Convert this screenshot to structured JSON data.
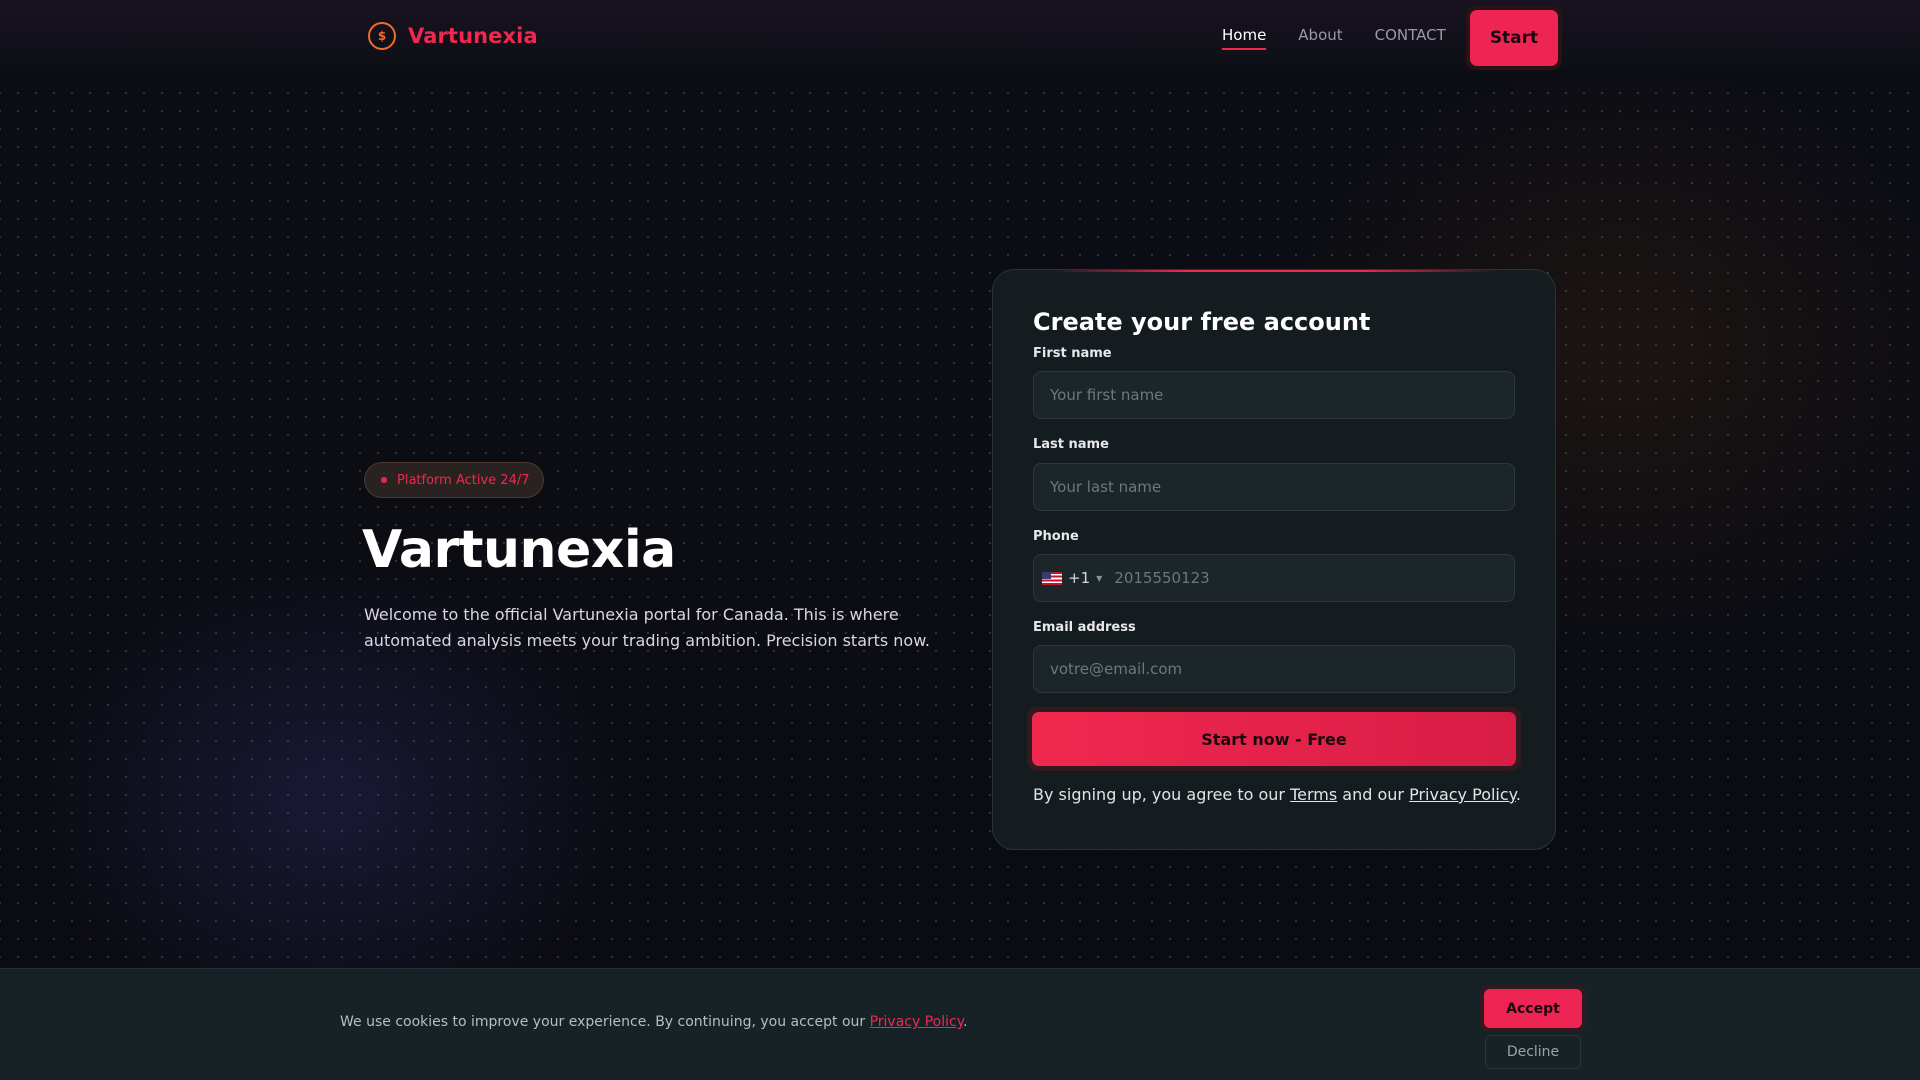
{
  "header": {
    "brand_name": "Vartunexia",
    "brand_icon_glyph": "$",
    "nav": [
      {
        "label": "Home",
        "active": true
      },
      {
        "label": "About",
        "active": false
      },
      {
        "label": "CONTACT",
        "active": false
      }
    ],
    "start_label": "Start"
  },
  "hero": {
    "badge": "Platform Active 24/7",
    "title": "Vartunexia",
    "text": "Welcome to the official Vartunexia portal for Canada. This is where automated analysis meets your trading ambition. Precision starts now."
  },
  "form": {
    "title": "Create your free account",
    "first_name": {
      "label": "First name",
      "placeholder": "Your first name"
    },
    "last_name": {
      "label": "Last name",
      "placeholder": "Your last name"
    },
    "phone": {
      "label": "Phone",
      "country_code": "+1",
      "placeholder": "2015550123"
    },
    "email": {
      "label": "Email address",
      "placeholder": "votre@email.com"
    },
    "submit_label": "Start now - Free",
    "terms_prefix": "By signing up, you agree to our ",
    "terms_link": "Terms",
    "terms_mid": " and our ",
    "privacy_link": "Privacy Policy",
    "terms_suffix": "."
  },
  "cookie": {
    "text": "We use cookies to improve your experience. By continuing, you accept our ",
    "link": "Privacy Policy",
    "suffix": ".",
    "accept_label": "Accept",
    "decline_label": "Decline"
  },
  "colors": {
    "accent": "#f0284f",
    "background": "#0b0c12",
    "card": "#151c1f",
    "brand_icon": "#f06a2a"
  }
}
